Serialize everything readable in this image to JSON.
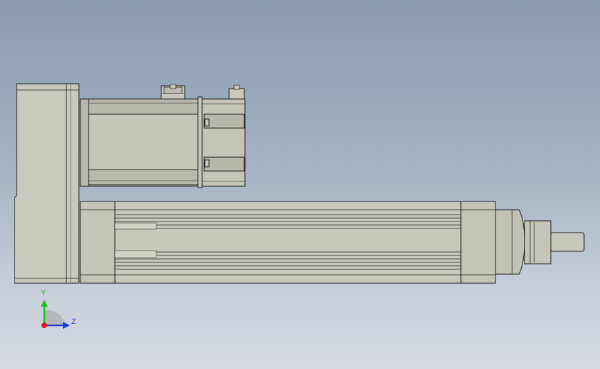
{
  "viewport": {
    "background_top": "#8a9bb2",
    "background_bottom": "#d6dbe2"
  },
  "model": {
    "body_color": "#c8c8bc",
    "edge_color": "#1e1e1e",
    "shade_color": "#a9a99e"
  },
  "triad": {
    "y_label": "Y",
    "z_label": "Z",
    "y_color": "#18c018",
    "z_color": "#1b3fd8",
    "x_color": "#d81b1b"
  }
}
